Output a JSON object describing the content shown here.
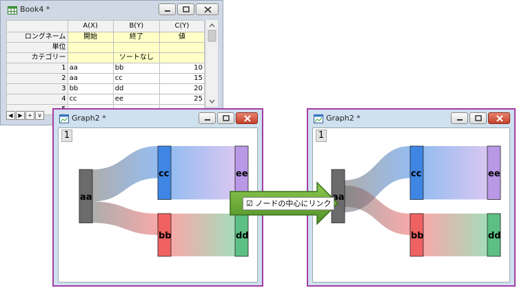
{
  "book": {
    "title": "Book4 *",
    "columns": [
      "A(X)",
      "B(Y)",
      "C(Y)"
    ],
    "meta_rows": [
      {
        "label": "ロングネーム",
        "values": [
          "開始",
          "終了",
          "値"
        ]
      },
      {
        "label": "単位",
        "values": [
          "",
          "",
          ""
        ]
      },
      {
        "label": "カテゴリー",
        "values": [
          "",
          "ソートなし",
          ""
        ]
      }
    ],
    "rows": [
      {
        "n": "1",
        "values": [
          "aa",
          "bb",
          "10"
        ]
      },
      {
        "n": "2",
        "values": [
          "aa",
          "cc",
          "15"
        ]
      },
      {
        "n": "3",
        "values": [
          "bb",
          "dd",
          "20"
        ]
      },
      {
        "n": "4",
        "values": [
          "cc",
          "ee",
          "25"
        ]
      },
      {
        "n": "5",
        "values": [
          "",
          "",
          ""
        ]
      }
    ],
    "sheet_nav": [
      "◀",
      "▶",
      "+",
      "∨"
    ]
  },
  "graph_left": {
    "title": "Graph2 *",
    "layer": "1"
  },
  "graph_right": {
    "title": "Graph2 *",
    "layer": "1"
  },
  "arrow": {
    "checkbox_mark": "☑",
    "label": "ノードの中心にリンク"
  },
  "sankey": {
    "nodes": [
      "aa",
      "bb",
      "cc",
      "dd",
      "ee"
    ],
    "links": [
      {
        "source": "aa",
        "target": "bb",
        "value": 10
      },
      {
        "source": "aa",
        "target": "cc",
        "value": 15
      },
      {
        "source": "bb",
        "target": "dd",
        "value": 20
      },
      {
        "source": "cc",
        "target": "ee",
        "value": 25
      }
    ],
    "colors": {
      "aa": "#6b6b6b",
      "bb": "#f06262",
      "cc": "#3f86e4",
      "dd": "#5cbf83",
      "ee": "#b998e6"
    }
  }
}
